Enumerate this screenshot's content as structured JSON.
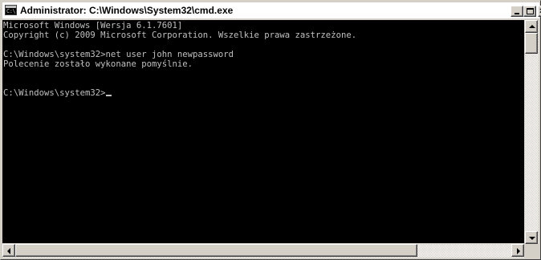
{
  "window": {
    "title": "Administrator: C:\\Windows\\System32\\cmd.exe",
    "icon": "cmd-icon",
    "icon_text": "C:\\",
    "controls": {
      "minimize": "minimize-icon",
      "maximize": "maximize-icon",
      "close": "close-icon",
      "close_glyph": "×"
    }
  },
  "console": {
    "background": "#000000",
    "foreground": "#c0c0c0",
    "lines": [
      "Microsoft Windows [Wersja 6.1.7601]",
      "Copyright (c) 2009 Microsoft Corporation. Wszelkie prawa zastrzeżone.",
      "",
      "C:\\Windows\\system32>net user john newpassword",
      "Polecenie zostało wykonane pomyślnie.",
      "",
      "",
      "C:\\Windows\\system32>"
    ]
  }
}
